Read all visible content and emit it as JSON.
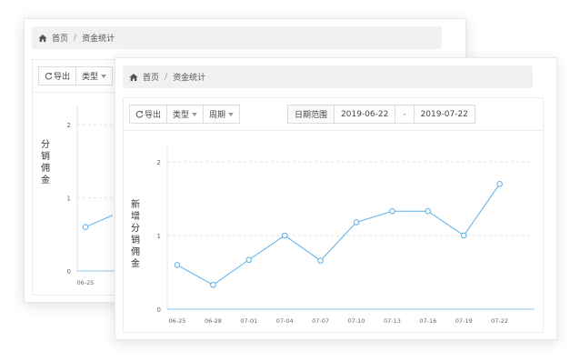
{
  "breadcrumb": {
    "home": "首页",
    "separator": "/",
    "current": "资金统计"
  },
  "toolbar": {
    "export_label": "导出",
    "type_label": "类型",
    "period_label": "周期"
  },
  "date_range": {
    "label": "日期范围",
    "start": "2019-06-22",
    "separator": "-",
    "end": "2019-07-22"
  },
  "back_card": {
    "ylabel": "分销佣金"
  },
  "front_card": {
    "ylabel": "新增分销佣金"
  },
  "icons": {
    "home": "home-icon",
    "refresh": "refresh-icon",
    "dropdown": "caret-down-icon"
  },
  "colors": {
    "line": "#5aaee8",
    "marker_fill": "#ffffff",
    "axis": "#8cc8ee",
    "grid": "#e6e6e6",
    "tick_text": "#666666"
  },
  "chart_data": [
    {
      "type": "line",
      "ylabel": "新增分销佣金",
      "x": [
        "06-25",
        "06-28",
        "07-01",
        "07-04",
        "07-07",
        "07-10",
        "07-13",
        "07-16",
        "07-19",
        "07-22"
      ],
      "y": [
        0.6,
        0.33,
        0.67,
        1.0,
        0.66,
        1.18,
        1.33,
        1.33,
        1.0,
        1.7
      ],
      "ylim": [
        0,
        2
      ],
      "yticks": [
        0,
        1,
        2
      ],
      "grid": true
    },
    {
      "type": "line",
      "ylabel": "分销佣金",
      "x": [
        "06-25"
      ],
      "y": [
        0.6
      ],
      "ylim": [
        0,
        2
      ],
      "yticks": [
        0,
        1,
        2
      ],
      "grid": true
    }
  ]
}
